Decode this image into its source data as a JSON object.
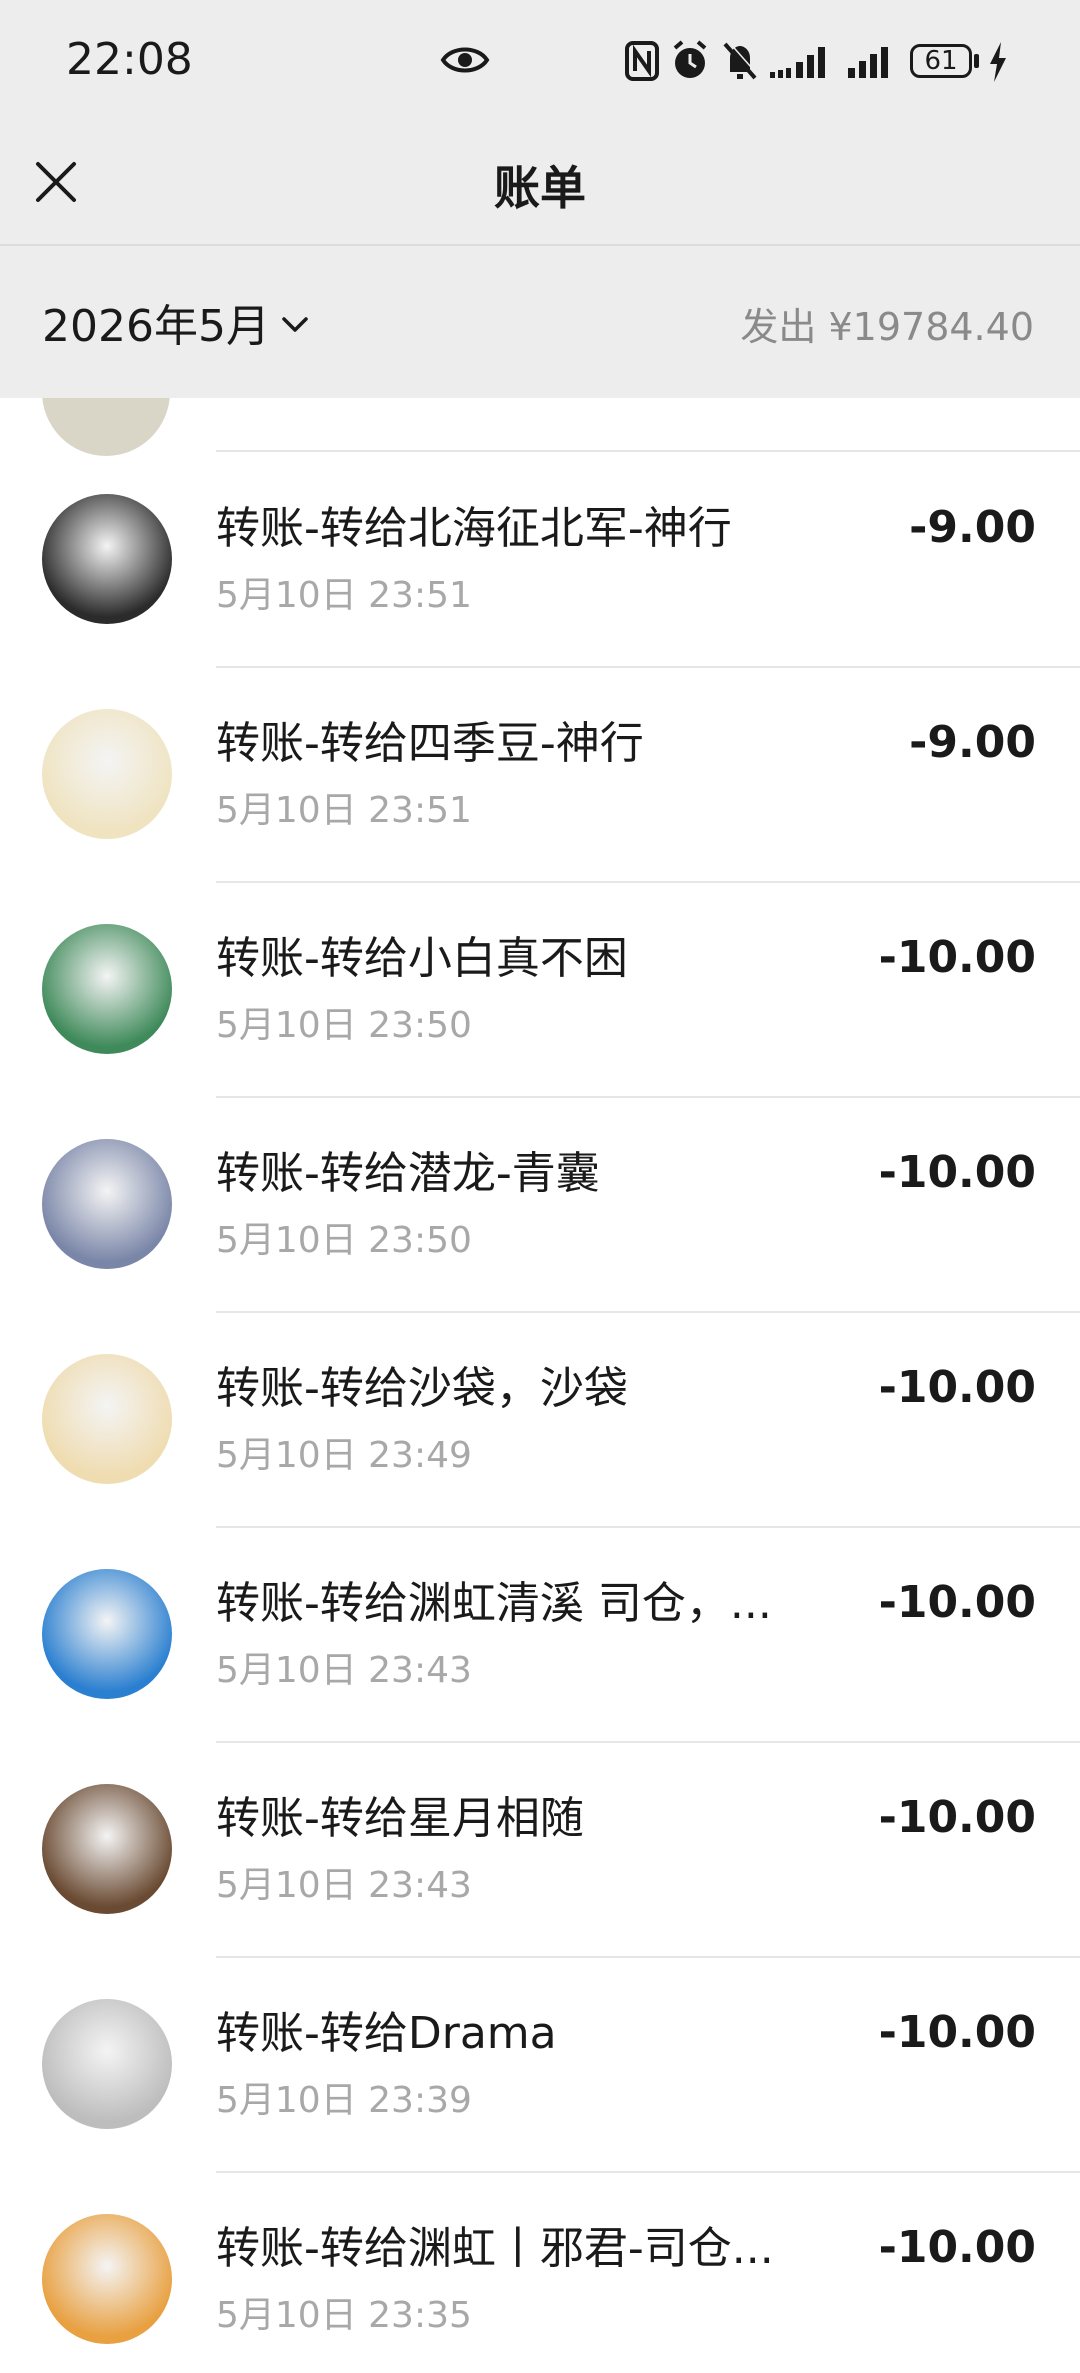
{
  "status_bar": {
    "time": "22:08",
    "battery": "61",
    "icons": [
      "eye-icon",
      "nfc-icon",
      "alarm-icon",
      "mute-icon",
      "signal-icon",
      "signal-icon",
      "battery-icon",
      "charging-icon"
    ]
  },
  "nav": {
    "title": "账单",
    "close_icon": "close-icon"
  },
  "filter": {
    "month": "2026年5月",
    "summary_label": "发出",
    "summary_amount": "¥19784.40"
  },
  "transactions": [
    {
      "title": "转账-转给北海征北军-神行",
      "time": "5月10日 23:51",
      "amount": "-9.00",
      "avatar_color": "#2b2b2b"
    },
    {
      "title": "转账-转给四季豆-神行",
      "time": "5月10日 23:51",
      "amount": "-9.00",
      "avatar_color": "#efe3c0"
    },
    {
      "title": "转账-转给小白真不困",
      "time": "5月10日 23:50",
      "amount": "-10.00",
      "avatar_color": "#3f8a5a"
    },
    {
      "title": "转账-转给潜龙-青囊",
      "time": "5月10日 23:50",
      "amount": "-10.00",
      "avatar_color": "#7a86a8"
    },
    {
      "title": "转账-转给沙袋，沙袋",
      "time": "5月10日 23:49",
      "amount": "-10.00",
      "avatar_color": "#efdcb0"
    },
    {
      "title": "转账-转给渊虹清溪 司仓，...",
      "time": "5月10日 23:43",
      "amount": "-10.00",
      "avatar_color": "#2a7fd0"
    },
    {
      "title": "转账-转给星月相随",
      "time": "5月10日 23:43",
      "amount": "-10.00",
      "avatar_color": "#6a4a32"
    },
    {
      "title": "转账-转给Drama",
      "time": "5月10日 23:39",
      "amount": "-10.00",
      "avatar_color": "#bdbdbd"
    },
    {
      "title": "转账-转给渊虹丨邪君-司仓...",
      "time": "5月10日 23:35",
      "amount": "-10.00",
      "avatar_color": "#e8a040"
    }
  ]
}
